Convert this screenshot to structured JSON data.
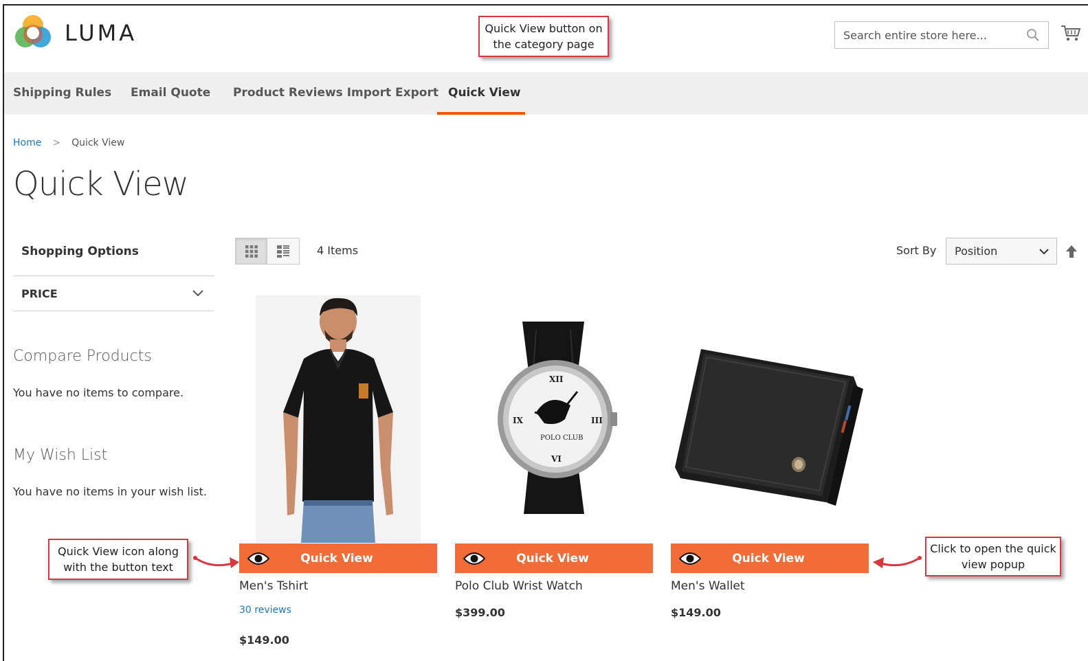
{
  "brand": {
    "name": "LUMA"
  },
  "search": {
    "placeholder": "Search entire store here..."
  },
  "nav": {
    "items": [
      {
        "label": "Shipping Rules"
      },
      {
        "label": "Email Quote"
      },
      {
        "label": "Product Reviews Import Export"
      },
      {
        "label": "Quick View",
        "active": true
      }
    ]
  },
  "breadcrumbs": {
    "home": "Home",
    "separator": ">",
    "current": "Quick View"
  },
  "page": {
    "title": "Quick View"
  },
  "sidebar": {
    "shopping_options": "Shopping Options",
    "filter_label": "PRICE",
    "compare_title": "Compare Products",
    "compare_empty": "You have no items to compare.",
    "wishlist_title": "My Wish List",
    "wishlist_empty": "You have no items in your wish list."
  },
  "toolbar": {
    "count": "4 Items",
    "sort_label": "Sort By",
    "sort_value": "Position"
  },
  "products": [
    {
      "name": "Men's Tshirt",
      "reviews": "30 reviews",
      "price": "$149.00",
      "button": "Quick View"
    },
    {
      "name": "Polo Club Wrist Watch",
      "price": "$399.00",
      "button": "Quick View"
    },
    {
      "name": "Men's Wallet",
      "price": "$149.00",
      "button": "Quick View"
    }
  ],
  "annotations": {
    "top": "Quick View button on the category page",
    "left": "Quick View icon along with the button text",
    "right": "Click to open the quick view popup"
  },
  "colors": {
    "accent": "#f26c38",
    "nav_underline": "#ff5501",
    "link": "#1979c3",
    "annotation_border": "#d9363e"
  }
}
